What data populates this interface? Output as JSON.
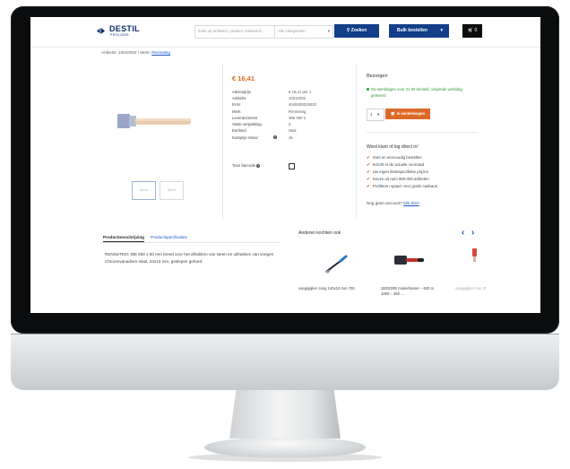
{
  "header": {
    "logo_text": "DESTIL",
    "logo_sub": "PROLIANS",
    "search_placeholder": "Zoek op artikelen, product, trefwoord...",
    "category_placeholder": "Alle categorieën",
    "search_button": "Zoeken",
    "bulk_button": "Bulk bestellen",
    "cart_count": "0"
  },
  "breadcrumb": {
    "prefix": "Artikelnr. 10010002 / Merk: ",
    "brand_link": "Rennsteig"
  },
  "product": {
    "price": "€ 16,41",
    "specs": [
      {
        "label": "Adviesprijs",
        "value": "€ 16,41 per 1"
      },
      {
        "label": "Artikelnr",
        "value": "10010002"
      },
      {
        "label": "EAN",
        "value": "4049300019002"
      },
      {
        "label": "Merk",
        "value": "Rennsteig"
      },
      {
        "label": "Leveranciersnr",
        "value": "385 050 1"
      },
      {
        "label": "Vaste verpakking",
        "value": "0"
      },
      {
        "label": "Eenheid",
        "value": "Stuk"
      },
      {
        "label": "Kostprijs retour",
        "value": "Ja"
      }
    ],
    "toon_label": "Toon barcode",
    "thumb1": "Beeld",
    "thumb2": "Beeld"
  },
  "order": {
    "heading": "Bezorgen",
    "stock_text": "Op werkdagen voor 21.30 besteld, volgende werkdag geleverd",
    "qty": "1",
    "add_button": "In winkelwagen"
  },
  "benefits": {
    "heading": "Word klant of log direct in!",
    "items": [
      "Snel en eenvoudig bestellen",
      "Inzicht in de actuele voorraad",
      "Uw eigen klantspecifieke prijzen",
      "Keuze uit ruim 850.000 artikelen",
      "Profiteren spaarr voor gratis cadeaus"
    ],
    "account_text": "Nog geen account?",
    "account_link": "Klik hier!"
  },
  "tabs": {
    "tab1": "Productomschrijving",
    "tab2": "Productspecificaties",
    "description": "RENNSTEIG 385 050 1 50 mm breed voor het afhakken van steen en uithakken van voegen. Chroomvanadium staal, 23x13 mm, geslepen gehard."
  },
  "related": {
    "heading": "Anderen kochten ook",
    "products": [
      {
        "caption": "voegspijker Jung 140x10 mm 700",
        "icon": "trowel-icon"
      },
      {
        "caption": "GEDORE mokerhamer – 620 m 1000 – 260 ...",
        "icon": "hammer-icon"
      },
      {
        "caption": "voegspijker mm 30021...",
        "icon": "tool-icon"
      }
    ]
  },
  "colors": {
    "brand_blue": "#123e8a",
    "accent_orange": "#dc6a26",
    "stock_green": "#2a9a2a"
  }
}
